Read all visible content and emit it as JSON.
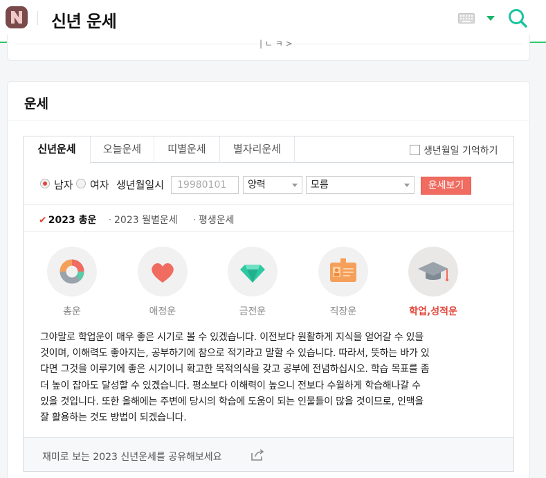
{
  "header": {
    "title": "신년 운세",
    "logo_letter": "N",
    "icons": [
      "keyboard-icon",
      "chevron-down-icon",
      "search-icon"
    ],
    "accent": "#1bb36a"
  },
  "prev_card": {
    "pager_text": "| ㄴ ㅋ >"
  },
  "card": {
    "title": "운세",
    "tabs": [
      {
        "label": "신년운세",
        "active": true
      },
      {
        "label": "오늘운세",
        "active": false
      },
      {
        "label": "띠별운세",
        "active": false
      },
      {
        "label": "별자리운세",
        "active": false
      }
    ],
    "remember_label": "생년월일 기억하기",
    "form": {
      "gender": [
        {
          "label": "남자",
          "selected": true
        },
        {
          "label": "여자",
          "selected": false
        }
      ],
      "birth_label": "생년월일시",
      "birth_placeholder": "19980101",
      "calendar_select": "양력",
      "time_select": "모름",
      "submit_label": "운세보기",
      "submit_color": "#f06b60"
    },
    "subtabs": [
      {
        "label": "2023 총운",
        "active": true
      },
      {
        "label": "2023 월별운세",
        "active": false
      },
      {
        "label": "평생운세",
        "active": false
      }
    ],
    "categories": [
      {
        "label": "총운",
        "icon": "donut-chart-icon",
        "active": false
      },
      {
        "label": "애정운",
        "icon": "heart-icon",
        "active": false
      },
      {
        "label": "금전운",
        "icon": "diamond-icon",
        "active": false
      },
      {
        "label": "직장운",
        "icon": "id-badge-icon",
        "active": false
      },
      {
        "label": "학업,성적운",
        "icon": "graduation-cap-icon",
        "active": true
      }
    ],
    "description": [
      "그야말로 학업운이 매우 좋은 시기로 볼 수 있겠습니다. 이전보다 원활하게 지식을 얻어갈 수 있을",
      "것이며, 이해력도 좋아지는, 공부하기에 참으로 적기라고 말할 수 있습니다. 따라서, 뜻하는 바가 있",
      "다면 그것을 이루기에 좋은 시기이니 확고한 목적의식을 갖고 공부에 전념하십시오. 학습 목표를 좀",
      "더 높이 잡아도 달성할 수 있겠습니다. 평소보다 이해력이 높으니 전보다 수월하게 학습해나갈 수",
      "있을 것입니다. 또한 올해에는 주변에 당시의 학습에 도움이 되는 인물들이 많을 것이므로, 인맥을",
      "잘 활용하는 것도 방법이 되겠습니다."
    ],
    "share_text": "재미로 보는 2023 신년운세를 공유해보세요"
  }
}
